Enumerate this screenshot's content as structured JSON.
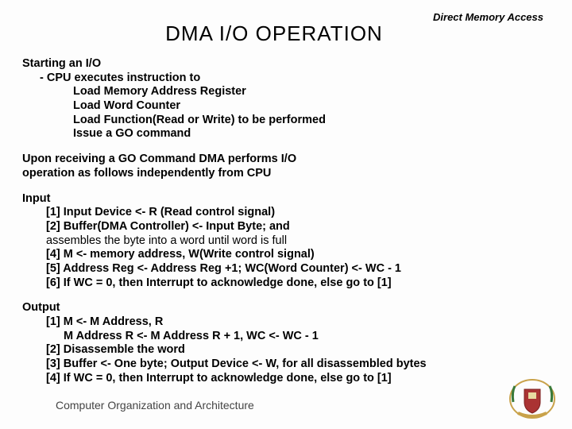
{
  "header_label": "Direct Memory Access",
  "title": "DMA  I/O  OPERATION",
  "section1": {
    "l0": "Starting an I/O",
    "l1": "- CPU executes instruction to",
    "l2": "Load Memory Address Register",
    "l3": "Load Word Counter",
    "l4": "Load Function(Read or Write) to be performed",
    "l5": "Issue a GO command"
  },
  "section2": {
    "l0": "Upon receiving a GO Command DMA performs I/O",
    "l1": "operation as follows independently from CPU"
  },
  "section3": {
    "l0": "Input",
    "l1": "[1] Input Device <- R (Read control signal)",
    "l2": "[2] Buffer(DMA Controller) <- Input Byte; and",
    "l3": "assembles the byte into a word until word is full",
    "l4": "[4] M <- memory address, W(Write control signal)",
    "l5": "[5] Address Reg <- Address Reg +1;  WC(Word Counter) <- WC - 1",
    "l6": "[6] If WC = 0, then Interrupt to acknowledge done, else go to [1]"
  },
  "section4": {
    "l0": "Output",
    "l1": "[1] M <- M Address, R",
    "l2": "M Address R <- M Address R + 1, WC <- WC - 1",
    "l3": "[2] Disassemble the word",
    "l4": "[3] Buffer <- One byte; Output Device <- W, for all disassembled bytes",
    "l5": "[4] If WC = 0, then Interrupt to acknowledge done, else go to [1]"
  },
  "footer": "Computer Organization and Architecture",
  "logo_name": "crest-logo"
}
